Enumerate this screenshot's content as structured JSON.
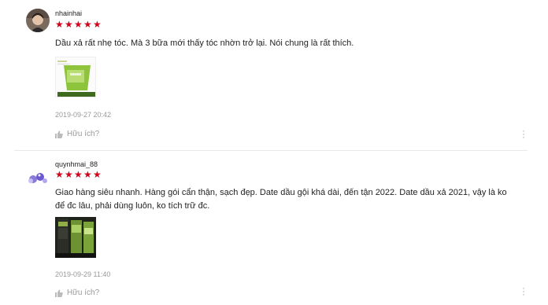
{
  "reviews": [
    {
      "username": "nhainhai",
      "rating": 5,
      "comment": "Dầu xả rất nhẹ tóc. Mà 3 bữa mới thấy tóc nhờn trở lại. Nói chung là rất thích.",
      "timestamp": "2019-09-27 20:42",
      "helpful_label": "Hữu ích?",
      "star_icon": "star-icon",
      "colors": {
        "star": "#d0011b"
      }
    },
    {
      "username": "quynhmai_88",
      "rating": 5,
      "comment": "Giao hàng siêu nhanh. Hàng gói cẩn thận, sạch đẹp. Date dầu gội khá dài, đến tận 2022. Date dầu xả 2021, vậy là ko để đc lâu, phải dùng luôn, ko tích trữ đc.",
      "timestamp": "2019-09-29 11:40",
      "helpful_label": "Hữu ích?",
      "star_icon": "star-icon",
      "colors": {
        "star": "#d0011b"
      }
    }
  ]
}
